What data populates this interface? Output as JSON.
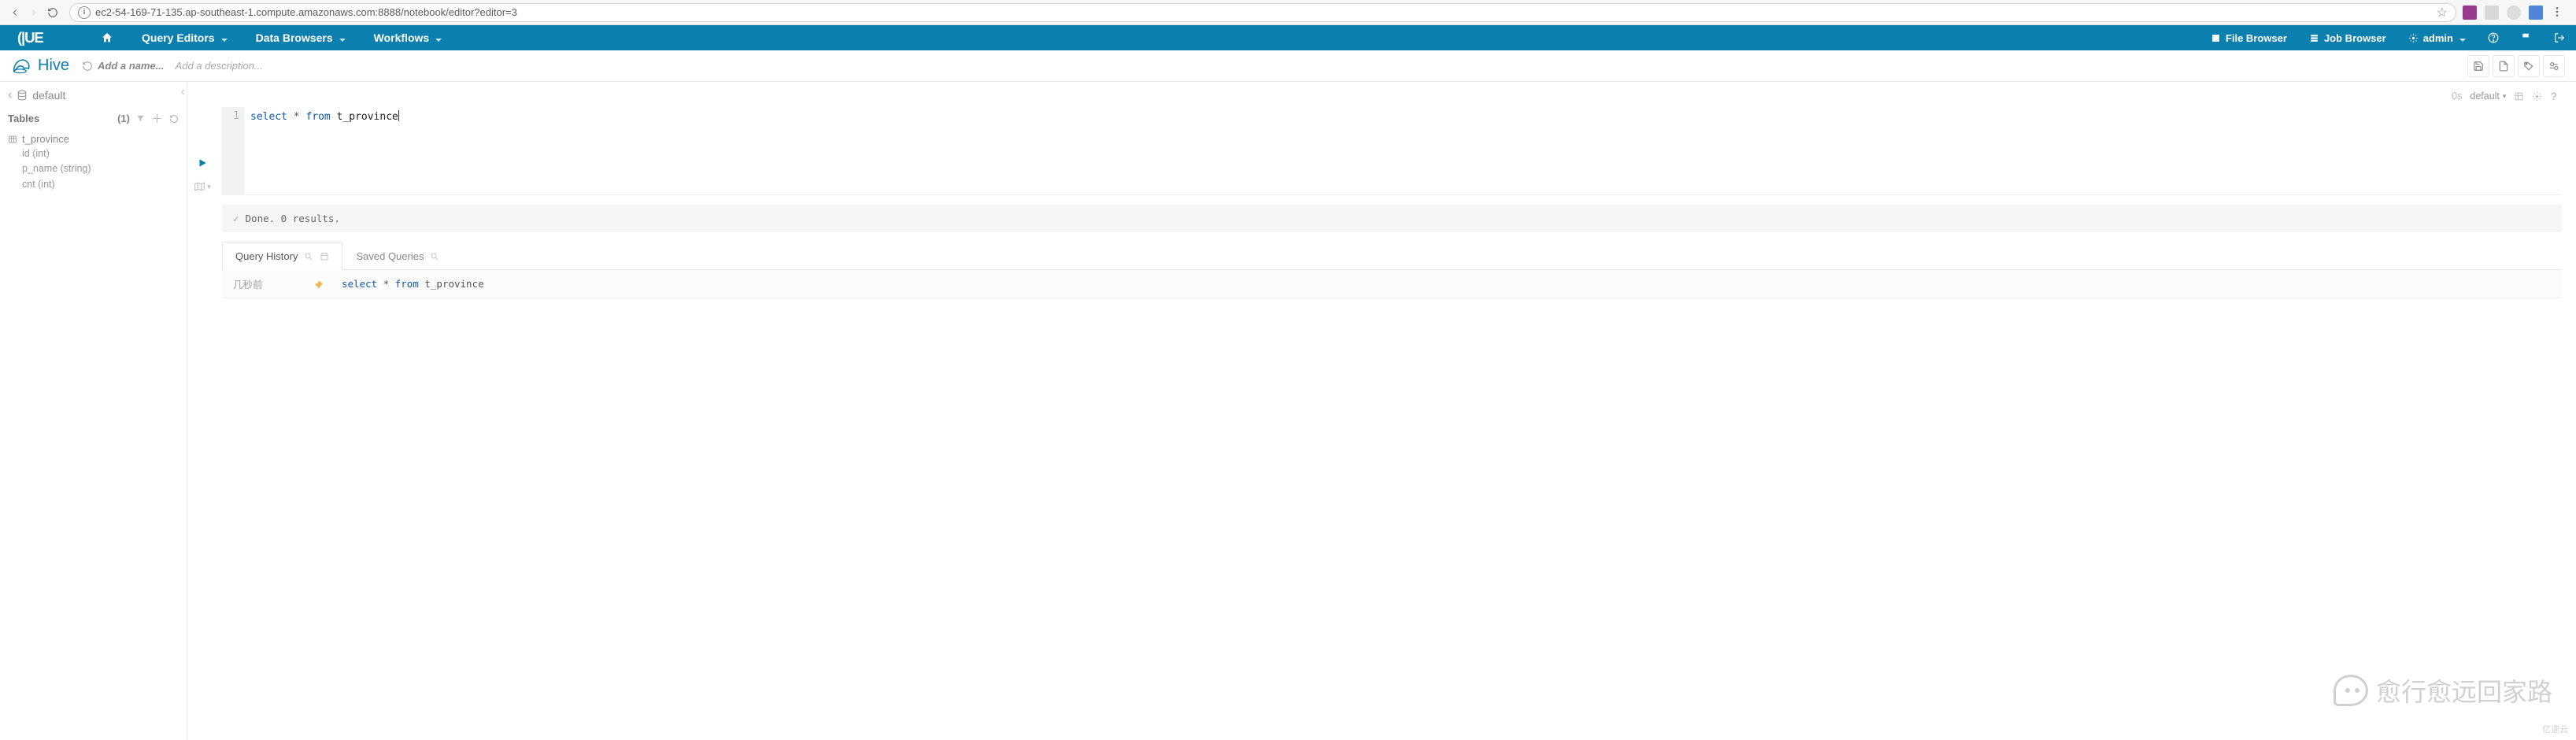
{
  "browser": {
    "url": "ec2-54-169-71-135.ap-southeast-1.compute.amazonaws.com:8888/notebook/editor?editor=3"
  },
  "appbar": {
    "logo": "HUE",
    "menus": {
      "query_editors": "Query Editors",
      "data_browsers": "Data Browsers",
      "workflows": "Workflows"
    },
    "right": {
      "file_browser": "File Browser",
      "job_browser": "Job Browser",
      "admin": "admin"
    }
  },
  "subheader": {
    "engine": "Hive",
    "name_placeholder": "Add a name...",
    "desc_placeholder": "Add a description..."
  },
  "assist": {
    "database": "default",
    "tables_label": "Tables",
    "count": "(1)",
    "table": {
      "name": "t_province",
      "columns": [
        "id (int)",
        "p_name (string)",
        "cnt (int)"
      ]
    }
  },
  "editor": {
    "elapsed": "0s",
    "database": "default",
    "line_number": "1",
    "query_kw_select": "select",
    "query_star": " * ",
    "query_kw_from": "from",
    "query_ident": " t_province"
  },
  "result": {
    "status": "Done. 0 results."
  },
  "tabs": {
    "history": "Query History",
    "saved": "Saved Queries"
  },
  "history": {
    "time": "几秒前",
    "sql_kw_select": "select",
    "sql_star": " * ",
    "sql_kw_from": "from",
    "sql_ident": " t_province"
  },
  "watermark": "愈行愈远回家路",
  "footer": "亿速云"
}
